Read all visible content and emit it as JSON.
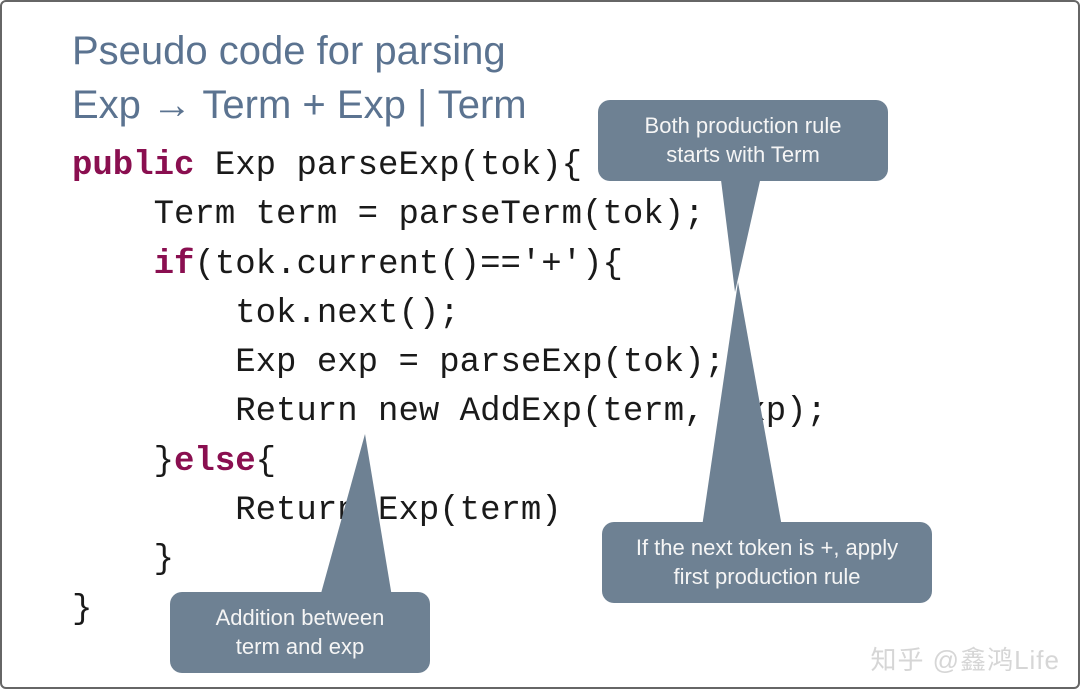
{
  "heading_line1": "Pseudo code for parsing",
  "heading_line2": "Exp → Term + Exp | Term",
  "code": {
    "l1a": "public",
    "l1b": " Exp parseExp(tok){",
    "l2": "    Term term = parseTerm(tok);",
    "l3a": "    ",
    "l3b": "if",
    "l3c": "(tok.current()=='+'){",
    "l4": "        tok.next();",
    "l5": "        Exp exp = parseExp(tok);",
    "l6": "        Return new AddExp(term, exp);",
    "l7a": "    }",
    "l7b": "else",
    "l7c": "{",
    "l8": "        Return Exp(term)",
    "l9": "    }",
    "l10": "}"
  },
  "callouts": {
    "c1": "Both production rule starts with Term",
    "c2": "If the next token is +, apply first production rule",
    "c3": "Addition between term and exp"
  },
  "watermark": "知乎 @鑫鸿Life"
}
